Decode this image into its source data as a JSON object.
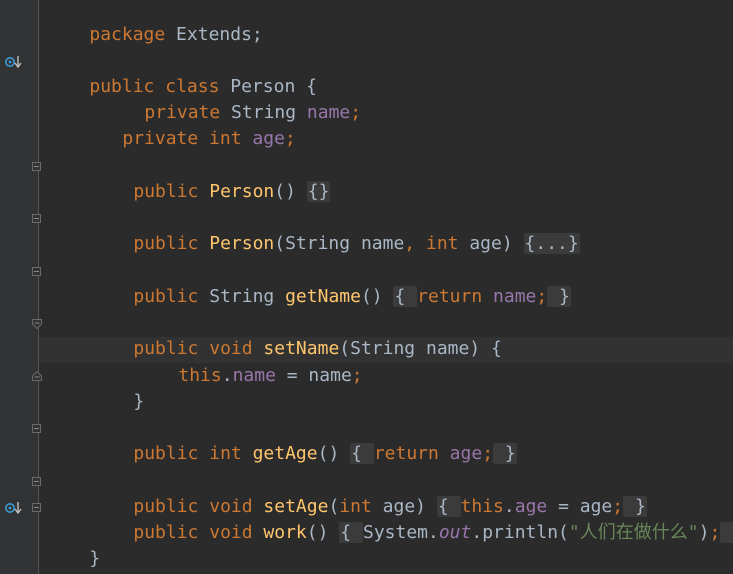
{
  "editor": {
    "language": "Java",
    "lines": {
      "l1": {
        "kw": "package",
        "rest": " Extends;"
      },
      "l3": {
        "kw1": "public",
        "kw2": " class",
        "rest": " Person {"
      },
      "l4": {
        "kw": "private",
        "type": " String ",
        "field": "name",
        "semi": ";"
      },
      "l5": {
        "kw": "private",
        "kw2": " int ",
        "field": "age",
        "semi": ";"
      },
      "l7": {
        "kw": "public",
        "fn": " Person",
        "rest": "() ",
        "fold": "{}"
      },
      "l9": {
        "kw": "public",
        "fn": " Person",
        "p1": "(String name",
        "comma": ",",
        "kw2": " int",
        "p2": " age) ",
        "fold": "{...}"
      },
      "l11": {
        "kw": "public",
        "type": " String ",
        "fn": "getName",
        "rest": "() ",
        "fold_open": "{ ",
        "kw2": "return",
        "field": " name",
        "semi": ";",
        "fold_close": " }"
      },
      "l13": {
        "kw": "public",
        "kw2": " void ",
        "fn": "setName",
        "rest": "(String name) {"
      },
      "l14": {
        "kw": "this",
        "dot": ".",
        "field": "name",
        "rest": " = name",
        "semi": ";"
      },
      "l15": {
        "rest": "}"
      },
      "l17": {
        "kw": "public",
        "kw2": " int ",
        "fn": "getAge",
        "rest": "() ",
        "fold_open": "{ ",
        "kw3": "return",
        "field": " age",
        "semi": ";",
        "fold_close": " }"
      },
      "l19": {
        "kw": "public",
        "kw2": " void ",
        "fn": "setAge",
        "p1": "(",
        "kw3": "int",
        "p2": " age) ",
        "fold_open": "{ ",
        "kw4": "this",
        "dot": ".",
        "field": "age",
        "rest": " = age",
        "semi": ";",
        "fold_close": " }"
      },
      "l20": {
        "kw": "public",
        "kw2": " void ",
        "fn": "work",
        "rest": "() ",
        "fold_open": "{ ",
        "sys": "System.",
        "out": "out",
        "call": ".println(",
        "str": "\"人们在做什么\"",
        "close": ")",
        "semi": ";",
        "fold_close": " }"
      },
      "l21": {
        "rest": "}"
      }
    },
    "colors": {
      "background": "#2b2b2b",
      "keyword": "#cc7832",
      "field": "#9876aa",
      "method": "#ffc66d",
      "string": "#6a8759",
      "text": "#a9b7c6"
    },
    "gutter_icons": [
      "override-icon",
      "override-icon"
    ]
  }
}
